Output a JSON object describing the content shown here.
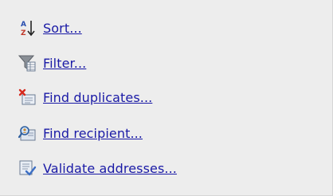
{
  "actions": {
    "sort": {
      "label": "Sort...",
      "icon": "sort-az-icon"
    },
    "filter": {
      "label": "Filter...",
      "icon": "filter-funnel-icon"
    },
    "find_duplicates": {
      "label": "Find duplicates...",
      "icon": "find-duplicates-icon"
    },
    "find_recipient": {
      "label": "Find recipient...",
      "icon": "find-recipient-icon"
    },
    "validate_addresses": {
      "label": "Validate addresses...",
      "icon": "validate-addresses-icon"
    }
  },
  "colors": {
    "background": "#ededed",
    "link": "#1a1aa6"
  },
  "sort_icon_letters": {
    "top": "A",
    "bottom": "Z"
  }
}
